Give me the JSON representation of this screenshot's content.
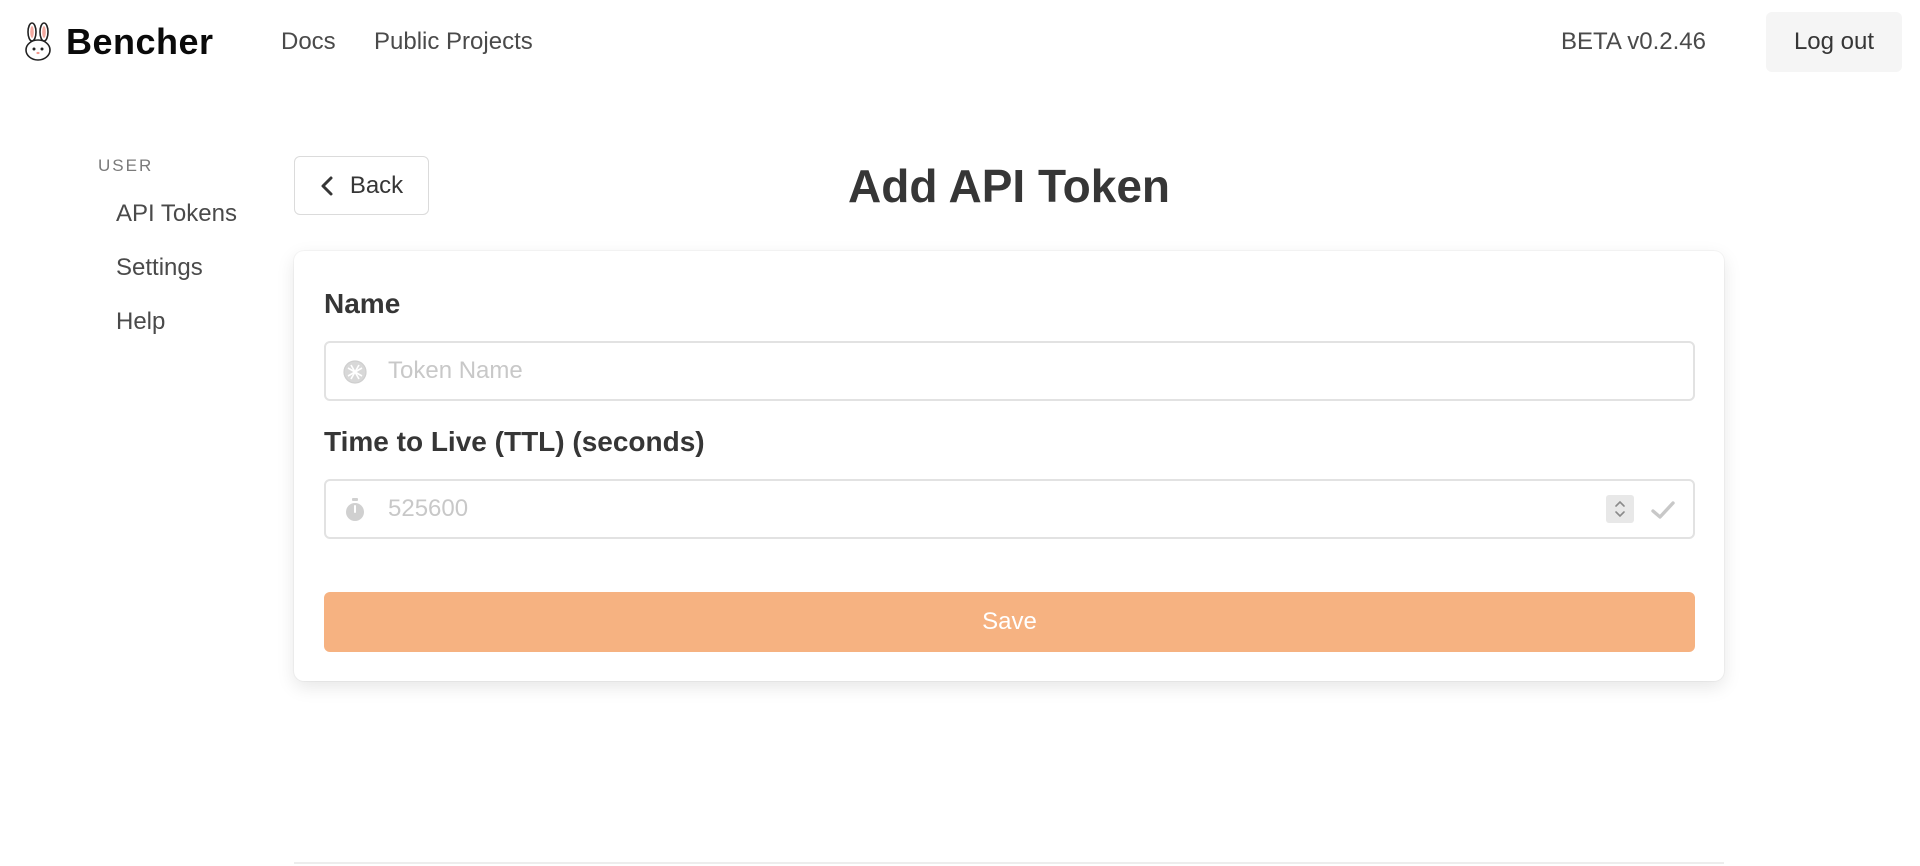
{
  "app": {
    "brand": "Bencher"
  },
  "navbar": {
    "docs": "Docs",
    "public_projects": "Public Projects",
    "version": "BETA v0.2.46",
    "logout": "Log out"
  },
  "sidebar": {
    "section_label": "USER",
    "items": [
      {
        "label": "API Tokens"
      },
      {
        "label": "Settings"
      },
      {
        "label": "Help"
      }
    ]
  },
  "main": {
    "back_label": "Back",
    "title": "Add API Token"
  },
  "form": {
    "name": {
      "label": "Name",
      "placeholder": "Token Name",
      "icon": "token-icon"
    },
    "ttl": {
      "label": "Time to Live (TTL) (seconds)",
      "placeholder": "525600",
      "icon": "stopwatch-icon"
    },
    "save_label": "Save"
  },
  "colors": {
    "save_button": "#f6b281",
    "logout_bg": "#f5f5f5",
    "text": "#363636"
  }
}
